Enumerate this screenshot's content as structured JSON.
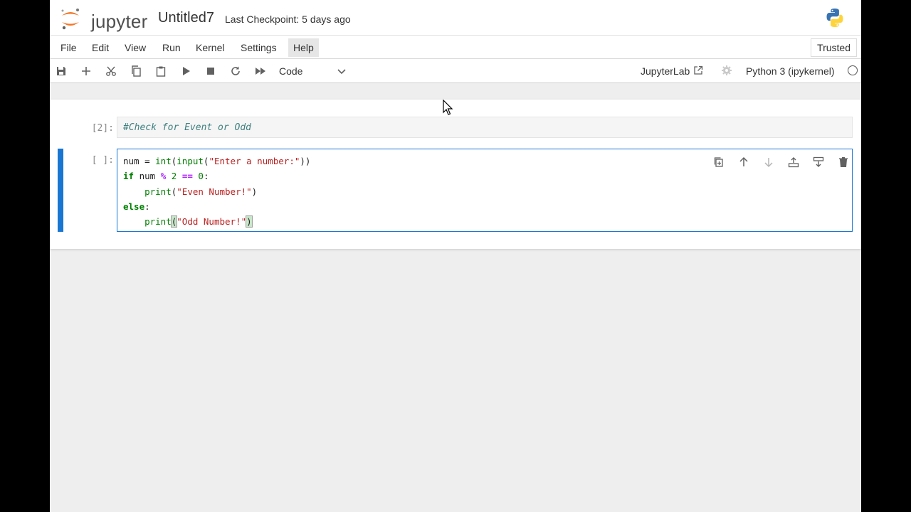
{
  "header": {
    "logo_text": "jupyter",
    "notebook_title": "Untitled7",
    "checkpoint": "Last Checkpoint: 5 days ago",
    "kernel_logo_icon": "python-logo-icon"
  },
  "menu": {
    "items": [
      "File",
      "Edit",
      "View",
      "Run",
      "Kernel",
      "Settings",
      "Help"
    ],
    "active": "Help",
    "trusted": "Trusted"
  },
  "toolbar": {
    "icons": [
      "save-icon",
      "add-cell-icon",
      "cut-icon",
      "copy-icon",
      "paste-icon",
      "run-icon",
      "stop-icon",
      "restart-icon",
      "fast-forward-icon"
    ],
    "cell_type": "Code",
    "jupyterlab_label": "JupyterLab",
    "kernel_name": "Python 3 (ipykernel)"
  },
  "cells": [
    {
      "type": "markdown",
      "prompt": "[2]:",
      "source": "#Check for Event or Odd"
    },
    {
      "type": "code",
      "prompt": "[ ]:",
      "lines": [
        "num = int(input(\"Enter a number:\"))",
        "if num % 2 == 0:",
        "    print(\"Even Number!\")",
        "else:",
        "    print(\"Odd Number!\")"
      ],
      "cell_toolbar_icons": [
        "duplicate-icon",
        "move-up-icon",
        "move-down-icon",
        "insert-above-icon",
        "insert-below-icon",
        "delete-icon"
      ]
    }
  ],
  "colors": {
    "accent": "#1976d2",
    "keyword": "#008000",
    "string": "#ba2121",
    "operator": "#aa22ff",
    "comment": "#408080"
  }
}
